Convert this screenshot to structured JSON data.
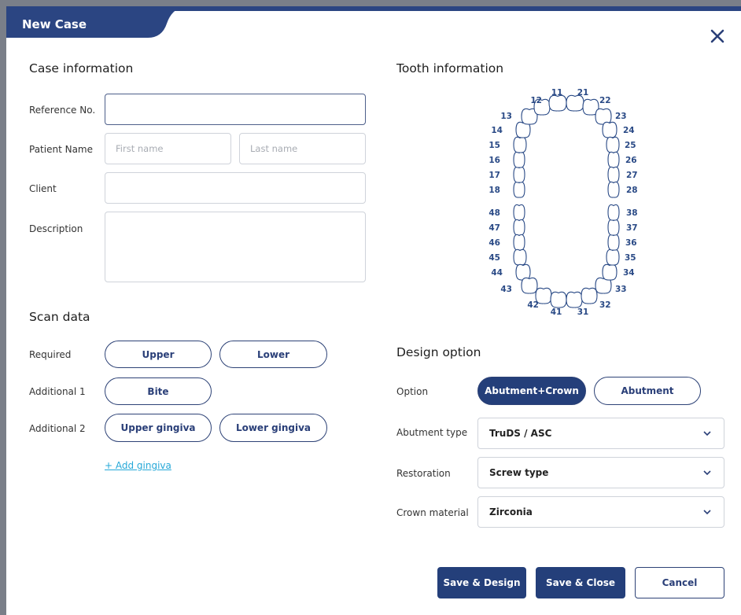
{
  "window": {
    "title": "New Case"
  },
  "case_info": {
    "heading": "Case information",
    "reference": {
      "label": "Reference No.",
      "value": "",
      "placeholder": ""
    },
    "patient": {
      "label": "Patient Name",
      "first_placeholder": "First name",
      "last_placeholder": "Last name"
    },
    "client": {
      "label": "Client",
      "value": ""
    },
    "description": {
      "label": "Description",
      "value": ""
    }
  },
  "scan_data": {
    "heading": "Scan data",
    "required": {
      "label": "Required",
      "buttons": [
        "Upper",
        "Lower"
      ]
    },
    "additional1": {
      "label": "Additional 1",
      "buttons": [
        "Bite"
      ]
    },
    "additional2": {
      "label": "Additional 2",
      "buttons": [
        "Upper gingiva",
        "Lower gingiva"
      ]
    },
    "add_gingiva": "+ Add gingiva"
  },
  "tooth_info": {
    "heading": "Tooth information",
    "upper": [
      "18",
      "17",
      "16",
      "15",
      "14",
      "13",
      "12",
      "11",
      "21",
      "22",
      "23",
      "24",
      "25",
      "26",
      "27",
      "28"
    ],
    "lower": [
      "48",
      "47",
      "46",
      "45",
      "44",
      "43",
      "42",
      "41",
      "31",
      "32",
      "33",
      "34",
      "35",
      "36",
      "37",
      "38"
    ]
  },
  "design": {
    "heading": "Design option",
    "option": {
      "label": "Option",
      "selected": "Abutment+Crown",
      "other": "Abutment"
    },
    "abutment_type": {
      "label": "Abutment type",
      "value": "TruDS / ASC"
    },
    "restoration": {
      "label": "Restoration",
      "value": "Screw type"
    },
    "crown_material": {
      "label": "Crown material",
      "value": "Zirconia"
    }
  },
  "footer": {
    "save_design": "Save & Design",
    "save_close": "Save & Close",
    "cancel": "Cancel"
  },
  "colors": {
    "primary": "#243f7a",
    "link": "#25a8d8",
    "tooth_label": "#2a4a86"
  }
}
